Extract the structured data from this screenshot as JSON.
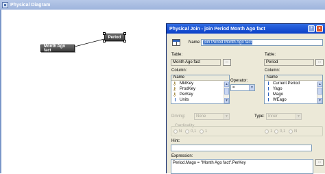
{
  "diagram": {
    "title": "Physical Diagram",
    "nodes": {
      "period": "Period",
      "month_ago_fact": "Month Ago fact"
    }
  },
  "dialog": {
    "title": "Physical Join - join Period Month Ago fact",
    "title_buttons": {
      "help": "?",
      "close": "×"
    },
    "name_label": "Name:",
    "name_value": "join Period Month Ago fact",
    "left": {
      "table_label": "Table:",
      "table_value": "Month Ago fact",
      "column_label": "Column:",
      "list_header": "Name",
      "items": [
        {
          "label": "MktKey",
          "icon": "key-icon"
        },
        {
          "label": "ProdKey",
          "icon": "key-icon"
        },
        {
          "label": "PerKey",
          "icon": "key-icon"
        },
        {
          "label": "Units",
          "icon": "column-icon"
        }
      ]
    },
    "operator": {
      "label": "Operator:",
      "value": "="
    },
    "right": {
      "table_label": "Table:",
      "table_value": "Period",
      "column_label": "Column:",
      "list_header": "Name",
      "items": [
        {
          "label": "Current Period",
          "icon": "column-icon"
        },
        {
          "label": "Yago",
          "icon": "column-icon"
        },
        {
          "label": "Mago",
          "icon": "column-icon"
        },
        {
          "label": "WEago",
          "icon": "column-icon"
        }
      ]
    },
    "driving": {
      "label": "Driving:",
      "value": "None"
    },
    "type": {
      "label": "Type:",
      "value": "Inner"
    },
    "cardinality": {
      "label": "Cardinality",
      "left_options": [
        "N",
        "0,1",
        "1"
      ],
      "right_options": [
        "1",
        "0,1",
        "N"
      ]
    },
    "hint": {
      "label": "Hint:",
      "value": ""
    },
    "expression": {
      "label": "Expression:",
      "value": "Period.Mago = \"Month Ago fact\".PerKey"
    },
    "ellipsis": "..."
  }
}
